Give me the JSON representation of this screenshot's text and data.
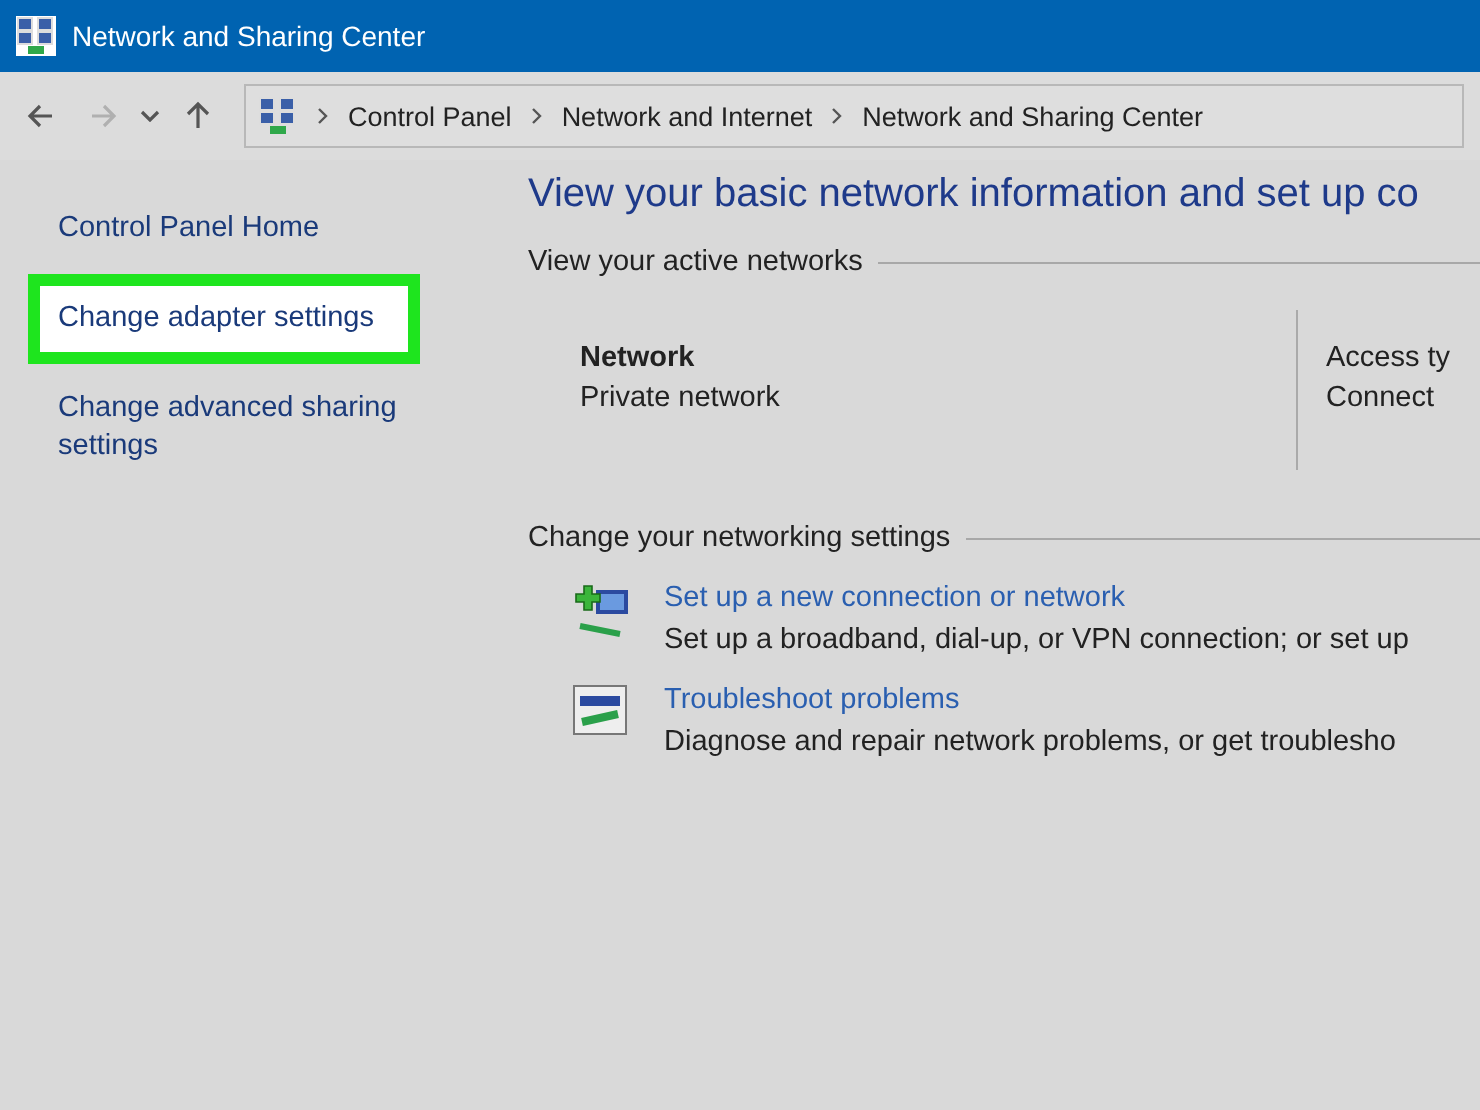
{
  "window": {
    "title": "Network and Sharing Center"
  },
  "navigation": {
    "buttons": [
      {
        "kind": "back",
        "disabled": false
      },
      {
        "kind": "forward",
        "disabled": true
      },
      {
        "kind": "recent",
        "disabled": false
      },
      {
        "kind": "up",
        "disabled": false
      }
    ],
    "breadcrumbs": [
      "Control Panel",
      "Network and Internet",
      "Network and Sharing Center"
    ]
  },
  "sidebar": {
    "items": [
      {
        "label": "Control Panel Home",
        "selected": false
      },
      {
        "label": "Change adapter settings",
        "selected": true
      },
      {
        "label": "Change advanced sharing settings",
        "selected": false
      }
    ]
  },
  "main": {
    "heading": "View your basic network information and set up co",
    "active_networks": {
      "heading": "View your active networks",
      "network_name": "Network",
      "network_type": "Private network",
      "column_2": [
        "Access ty",
        "Connect"
      ]
    },
    "settings": {
      "heading": "Change your networking settings",
      "tasks": [
        {
          "kind": "new-connection",
          "link": "Set up a new connection or network",
          "description": "Set up a broadband, dial-up, or VPN connection; or set up"
        },
        {
          "kind": "troubleshoot",
          "link": "Troubleshoot problems",
          "description": "Diagnose and repair network problems, or get troublesho"
        }
      ]
    }
  }
}
